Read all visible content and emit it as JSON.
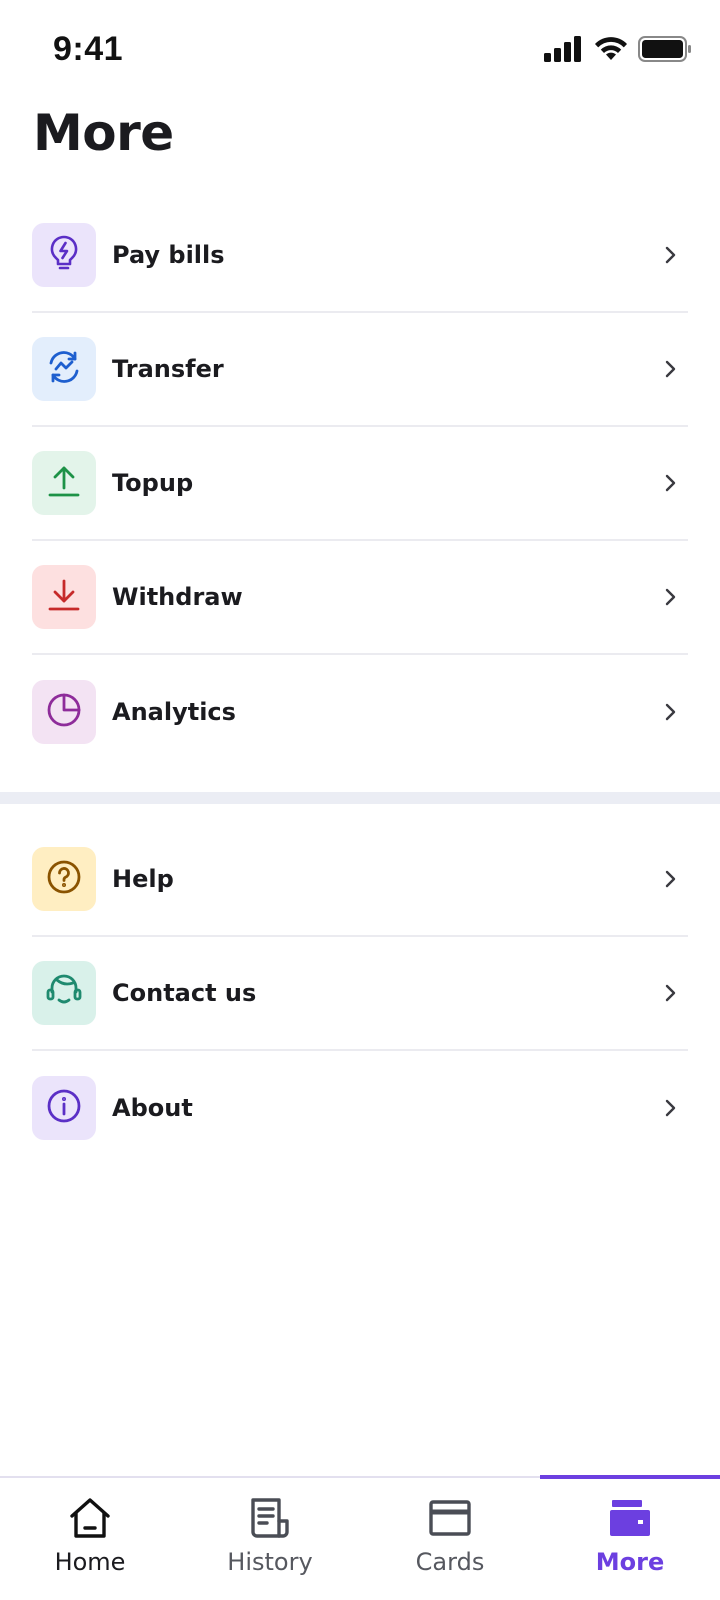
{
  "status_bar": {
    "time": "9:41",
    "icons": [
      "signal-icon",
      "wifi-icon",
      "battery-icon"
    ]
  },
  "page": {
    "title": "More"
  },
  "primary_menu": [
    {
      "label": "Pay bills",
      "icon": "lightbulb-icon",
      "bg": "#ebe4fb",
      "color": "#5b2fc6"
    },
    {
      "label": "Transfer",
      "icon": "transfer-cycle-icon",
      "bg": "#e3eefc",
      "color": "#1e5fcf"
    },
    {
      "label": "Topup",
      "icon": "upload-icon",
      "bg": "#e3f4ea",
      "color": "#1d9247"
    },
    {
      "label": "Withdraw",
      "icon": "download-icon",
      "bg": "#fde0e0",
      "color": "#c62a2a"
    },
    {
      "label": "Analytics",
      "icon": "pie-chart-icon",
      "bg": "#f3e3f3",
      "color": "#8e2c9a"
    }
  ],
  "secondary_menu": [
    {
      "label": "Help",
      "icon": "question-circle-icon",
      "bg": "#ffeec2",
      "color": "#8a5300"
    },
    {
      "label": "Contact us",
      "icon": "headset-icon",
      "bg": "#d9f1ea",
      "color": "#1f8a6f"
    },
    {
      "label": "About",
      "icon": "info-circle-icon",
      "bg": "#ebe4fb",
      "color": "#5b2fc6"
    }
  ],
  "bottom_nav": {
    "active": "More",
    "items": [
      {
        "label": "Home",
        "icon": "home-icon"
      },
      {
        "label": "History",
        "icon": "receipt-icon"
      },
      {
        "label": "Cards",
        "icon": "card-icon"
      },
      {
        "label": "More",
        "icon": "wallet-icon"
      }
    ]
  },
  "colors": {
    "accent": "#6c3fe0",
    "text": "#1b1b1f",
    "muted": "#56585f",
    "divider": "#ebebf0"
  }
}
